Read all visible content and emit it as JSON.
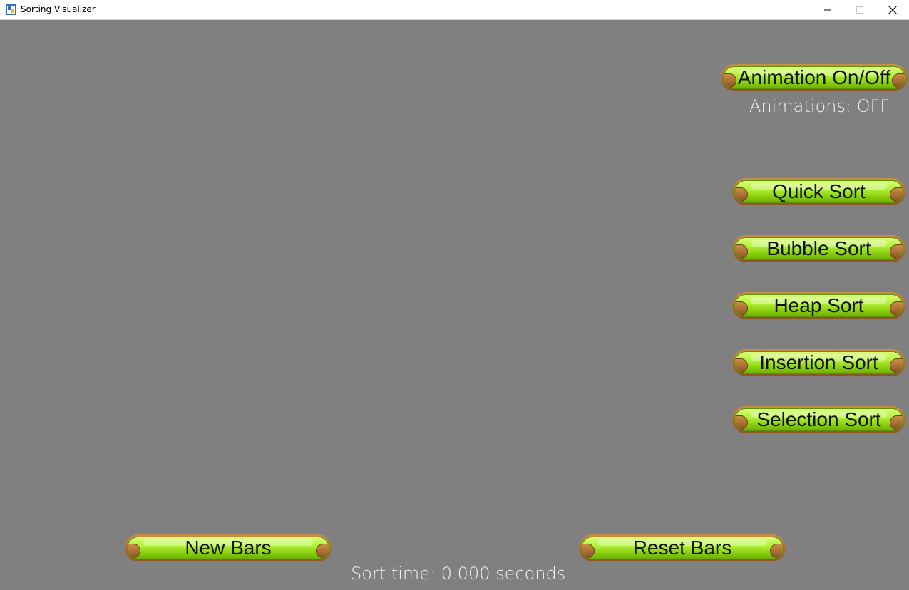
{
  "window": {
    "title": "Sorting Visualizer",
    "controls": {
      "minimize": "minimize-icon",
      "maximize": "maximize-icon",
      "close": "close-icon"
    }
  },
  "panel": {
    "animation_button": "Animation On/Off",
    "animation_status": "Animations: OFF",
    "sort_buttons": [
      "Quick Sort",
      "Bubble Sort",
      "Heap Sort",
      "Insertion Sort",
      "Selection Sort"
    ]
  },
  "bottom": {
    "new_bars": "New Bars",
    "reset_bars": "Reset Bars",
    "sort_time": "Sort time: 0.000 seconds"
  },
  "colors": {
    "background": "#808080",
    "button_green": "#a5e82a",
    "button_wood": "#a8682e",
    "text_light": "#f2f2f2"
  }
}
